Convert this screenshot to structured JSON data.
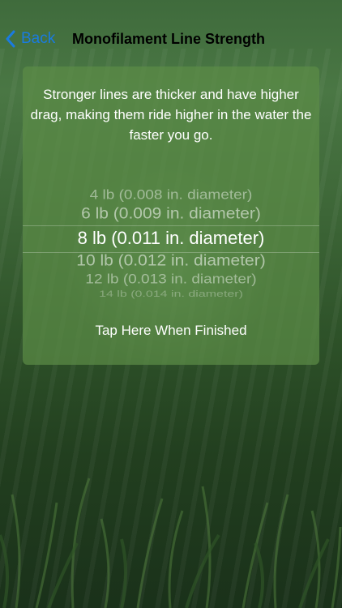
{
  "nav": {
    "back_label": "Back",
    "title": "Monofilament Line Strength",
    "accent_color": "#1a7be0"
  },
  "panel": {
    "description": "Stronger lines are thicker and have higher drag, making them ride higher in the water the faster you go.",
    "picker": {
      "options": [
        "4 lb (0.008 in. diameter)",
        "6 lb (0.009 in. diameter)",
        "8 lb (0.011 in. diameter)",
        "10 lb (0.012 in. diameter)",
        "12 lb (0.013 in. diameter)",
        "14 lb (0.014 in. diameter)"
      ],
      "selected": "8 lb (0.011 in. diameter)"
    },
    "finish_label": "Tap Here When Finished"
  },
  "icons": {
    "back": "chevron-left-icon"
  }
}
